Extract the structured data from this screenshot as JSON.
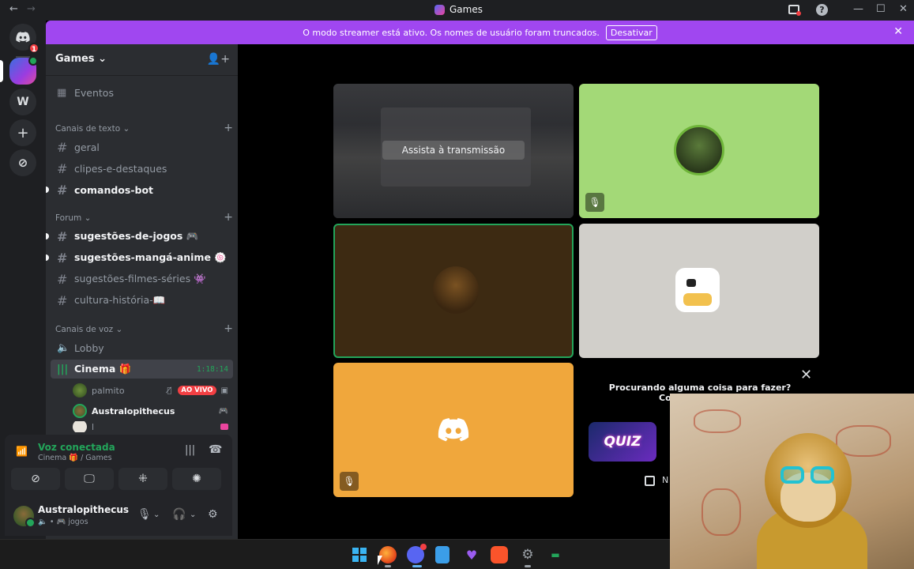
{
  "window": {
    "title": "Games",
    "back": "←",
    "forward": "→",
    "help": "?",
    "minimize": "—",
    "maximize": "☐",
    "close": "✕"
  },
  "rail": {
    "dm_badge": "1",
    "server_letter": "W",
    "add": "+",
    "explore": "⊘"
  },
  "banner": {
    "text": "O modo streamer está ativo. Os nomes de usuário foram truncados.",
    "button": "Desativar",
    "close": "✕"
  },
  "sidebar": {
    "guild_name": "Games ⌄",
    "events": "Eventos",
    "text_category": "Canais de texto ⌄",
    "forum_category": "Forum ⌄",
    "voice_category": "Canais de voz ⌄",
    "channels": {
      "geral": "geral",
      "clipes": "clipes-e-destaques",
      "comandos": "comandos-bot",
      "sugestoes_jogos": "sugestões-de-jogos 🎮",
      "sugestoes_manga": "sugestões-mangá-anime 🍥",
      "sugestoes_filmes": "sugestões-filmes-séries 👾",
      "cultura": "cultura-história-📖"
    },
    "voice": {
      "lobby": "Lobby",
      "cinema": "Cinema 🎁",
      "cinema_timer": "1:18:14",
      "users": [
        {
          "name": "palmito",
          "badge": "AO VIVO"
        },
        {
          "name": "Australopithecus"
        },
        {
          "name": "l"
        }
      ]
    }
  },
  "voice_panel": {
    "status": "Voz conectada",
    "location": "Cinema 🎁 / Games"
  },
  "user": {
    "name": "Australopithecus",
    "status": "🔈 • 🎮 jogos"
  },
  "stage": {
    "watch_button": "Assista à transmissão",
    "promo_title": "Procurando alguma coisa para fazer?\nComece u                                    in",
    "promo_title_line1": "Procurando alguma coisa para fazer?",
    "promo_title_line2": "Comece u",
    "quiz_label": "QUIZ",
    "promo_checkbox_label": "N"
  },
  "colors": {
    "banner": "#a047f0",
    "green_tile": "#a3d977",
    "brown_tile": "#3d2a12",
    "gray_tile": "#d1cfca",
    "orange_tile": "#f0a73c",
    "online": "#23a55a",
    "live": "#f23f43"
  },
  "taskbar_icons": [
    "windows-icon",
    "firefox-icon",
    "discord-icon",
    "notepad-icon",
    "heart-app-icon",
    "brave-icon",
    "settings-icon",
    "terminal-icon"
  ]
}
